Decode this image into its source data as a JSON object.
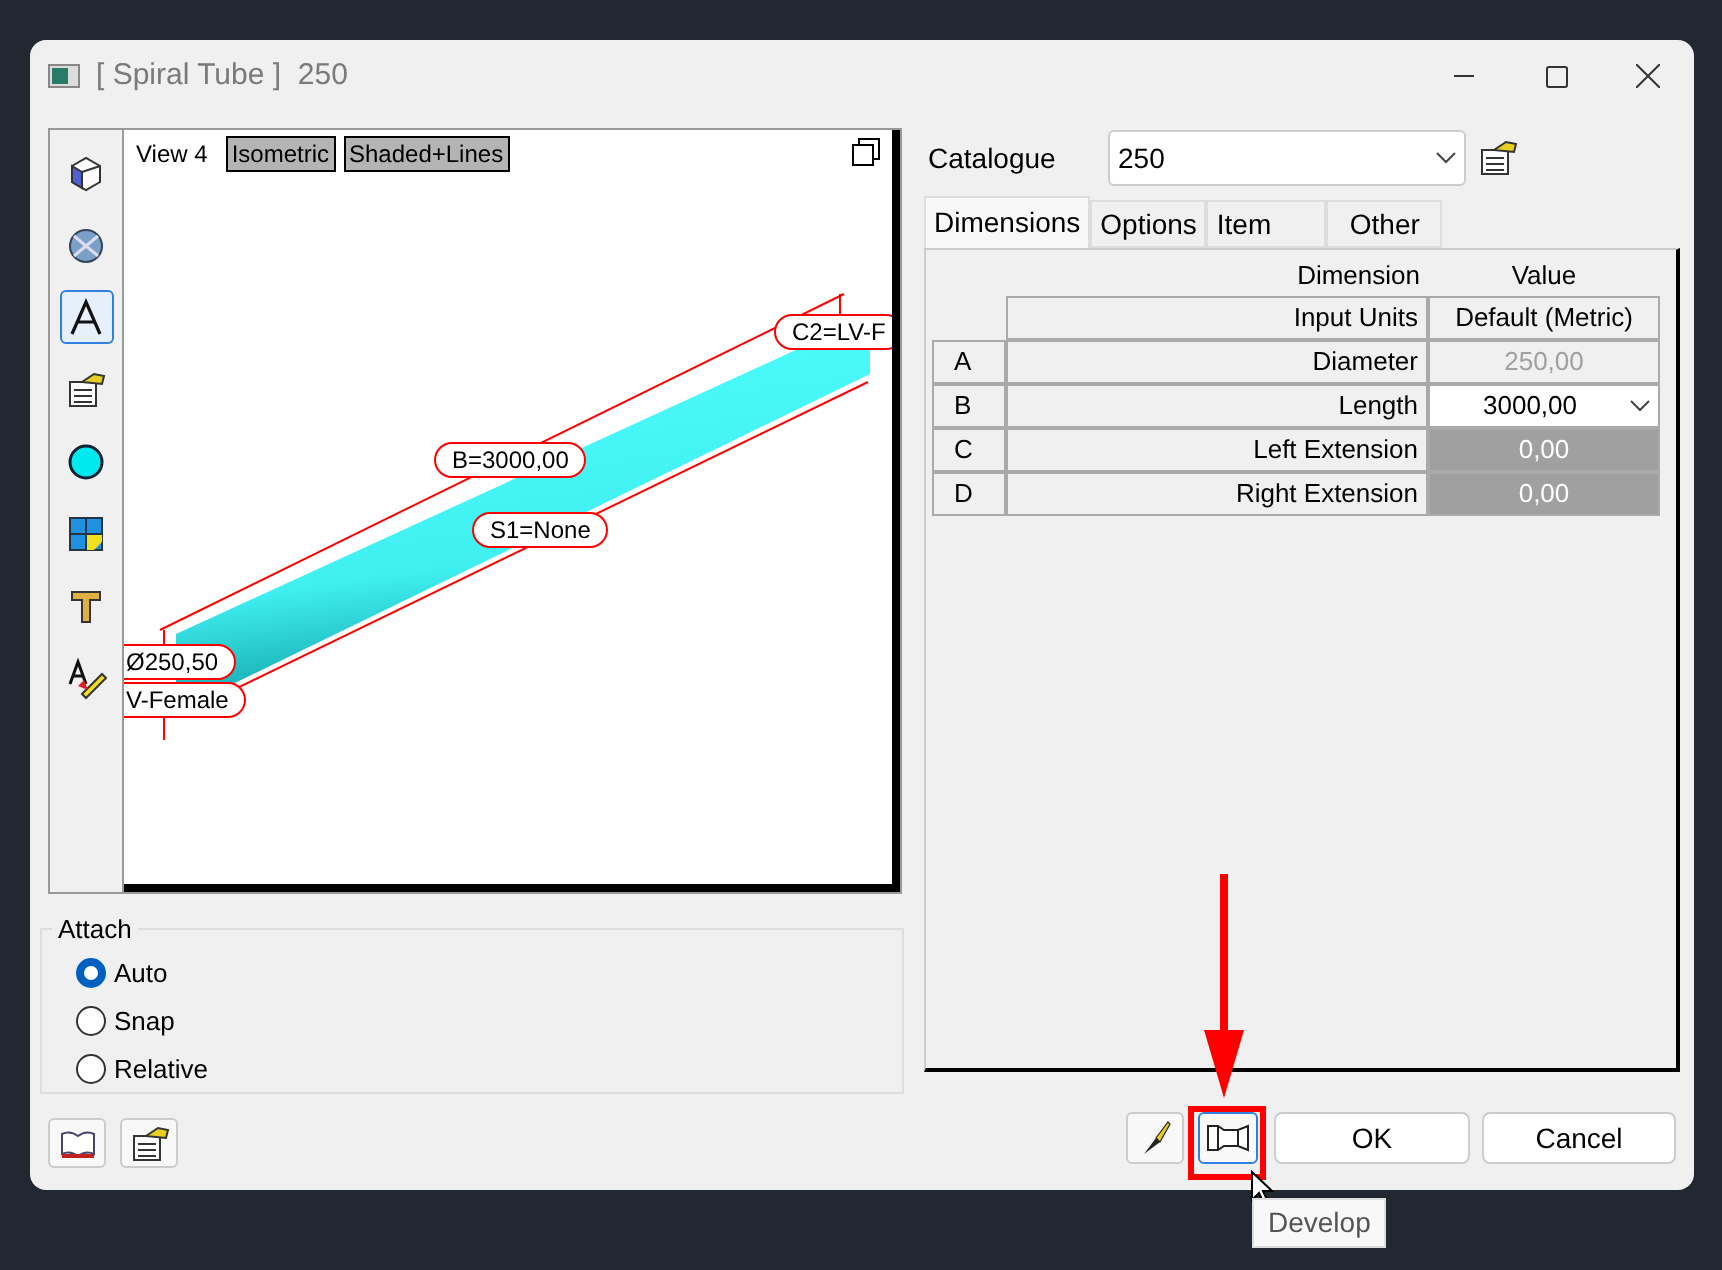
{
  "window": {
    "title": "[ Spiral Tube ]  250"
  },
  "toolbar": [
    {
      "selected": false
    },
    {
      "selected": false
    },
    {
      "selected": true
    },
    {
      "selected": false
    },
    {
      "selected": false
    },
    {
      "selected": false
    },
    {
      "selected": false
    },
    {
      "selected": false
    }
  ],
  "viewport": {
    "view": "View 4",
    "modes": [
      "Isometric",
      "Shaded+Lines"
    ],
    "labels": [
      {
        "text": "C2=LV-F"
      },
      {
        "text": "B=3000,00"
      },
      {
        "text": "S1=None"
      },
      {
        "text": "Ø250,50"
      },
      {
        "text": "V-Female"
      }
    ]
  },
  "attach": {
    "title": "Attach",
    "options": [
      {
        "label": "Auto",
        "selected": true
      },
      {
        "label": "Snap",
        "selected": false
      },
      {
        "label": "Relative",
        "selected": false
      }
    ]
  },
  "catalogue": {
    "label": "Catalogue",
    "value": "250"
  },
  "tabs": [
    {
      "label": "Dimensions",
      "selected": true
    },
    {
      "label": "Options",
      "selected": false
    },
    {
      "label": "Item",
      "selected": false
    },
    {
      "label": "Other",
      "selected": false
    }
  ],
  "table": {
    "columns": [
      "Dimension",
      "Value"
    ],
    "units": {
      "label": "Input Units",
      "value": "Default (Metric)"
    },
    "rows": [
      {
        "letter": "A",
        "name": "Diameter",
        "value": "250,00",
        "kind": "readonly"
      },
      {
        "letter": "B",
        "name": "Length",
        "value": "3000,00",
        "kind": "combo"
      },
      {
        "letter": "C",
        "name": "Left Extension",
        "value": "0,00",
        "kind": "locked"
      },
      {
        "letter": "D",
        "name": "Right Extension",
        "value": "0,00",
        "kind": "locked"
      }
    ]
  },
  "buttons": [
    "OK",
    "Cancel"
  ],
  "tooltip": "Develop"
}
